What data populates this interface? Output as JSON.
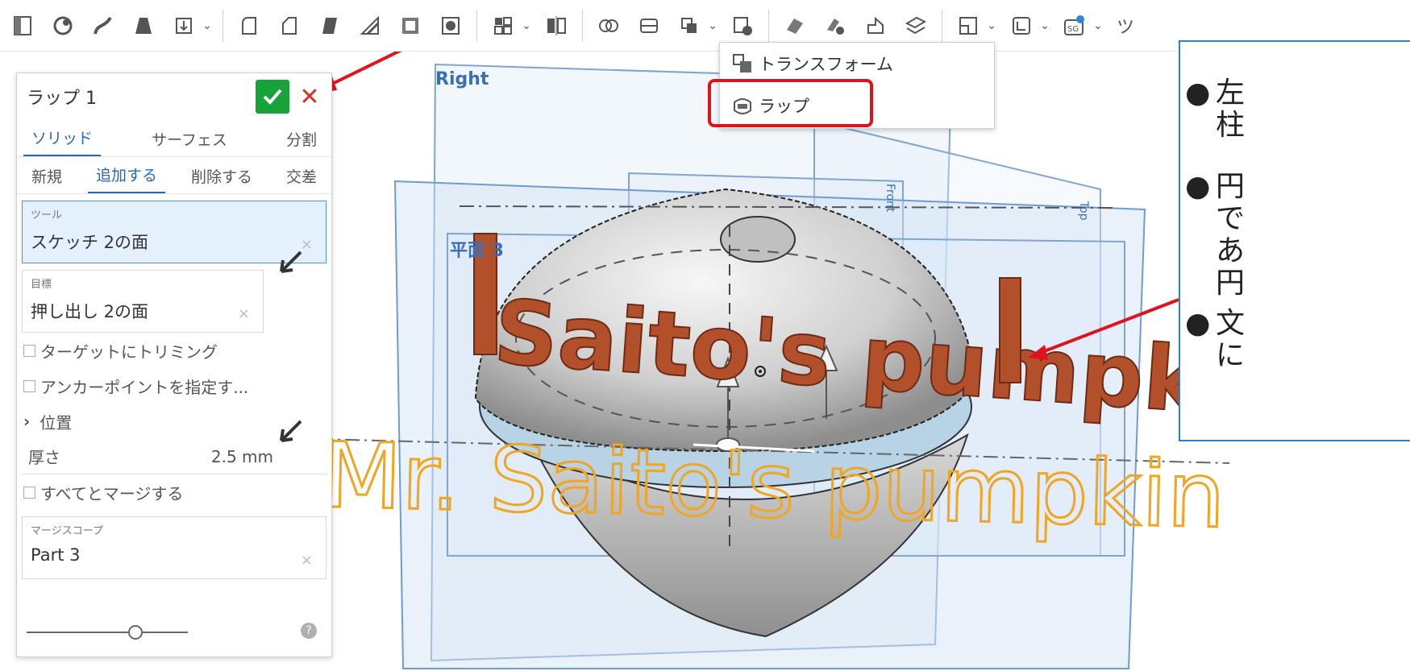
{
  "toolbar": {
    "icons": [
      "sketch-icon",
      "feature-icon",
      "sweep-icon",
      "loft-icon",
      "thicken-icon",
      "fillet-icon",
      "chamfer-icon",
      "draft-icon",
      "rib-icon",
      "shell-icon",
      "hole-icon",
      "pattern-icon",
      "mirror-icon",
      "boolean-icon",
      "split-icon",
      "transform-icon",
      "delete-icon",
      "move-face-icon",
      "replace-face-icon",
      "offset-surface-icon",
      "plane-icon",
      "helix-icon",
      "sg-icon",
      "more-icon"
    ],
    "more_label": "ツ"
  },
  "dropdown": {
    "items": [
      {
        "label": "トランスフォーム",
        "icon": "transform-icon"
      },
      {
        "label": "ラップ",
        "icon": "wrap-icon"
      }
    ]
  },
  "panel": {
    "title": "ラップ 1",
    "type_tabs": [
      "ソリッド",
      "サーフェス",
      "分割"
    ],
    "active_type_tab": "ソリッド",
    "op_tabs": [
      "新規",
      "追加する",
      "削除する",
      "交差"
    ],
    "active_op_tab": "追加する",
    "tool_label": "ツール",
    "tool_value": "スケッチ 2の面",
    "target_label": "目標",
    "target_value": "押し出し 2の面",
    "trim_label": "ターゲットにトリミング",
    "anchor_label": "アンカーポイントを指定す...",
    "position_label": "位置",
    "thickness_label": "厚さ",
    "thickness_value": "2.5 mm",
    "merge_all_label": "すべてとマージする",
    "merge_scope_label": "マージスコープ",
    "merge_scope_value": "Part 3",
    "help": "?"
  },
  "viewport": {
    "plane_right": "Right",
    "plane_3": "平面 3",
    "plane_top": "Top",
    "plane_front": "Front",
    "wrapped_text": "Saito's pumpk",
    "sketch_text": "Mr. Saito's pumpkin"
  },
  "callout": {
    "items": [
      {
        "lines": [
          "左",
          "柱"
        ]
      },
      {
        "lines": [
          "円",
          "で",
          "あ",
          "円"
        ]
      },
      {
        "lines": [
          "文",
          "に"
        ]
      }
    ]
  },
  "colors": {
    "accent": "#2966b8",
    "ok": "#17a338",
    "cancel": "#d2322d",
    "annotation_red": "#e0121e",
    "wrap_text": "#b3502c",
    "sketch_text": "#f0a623"
  }
}
